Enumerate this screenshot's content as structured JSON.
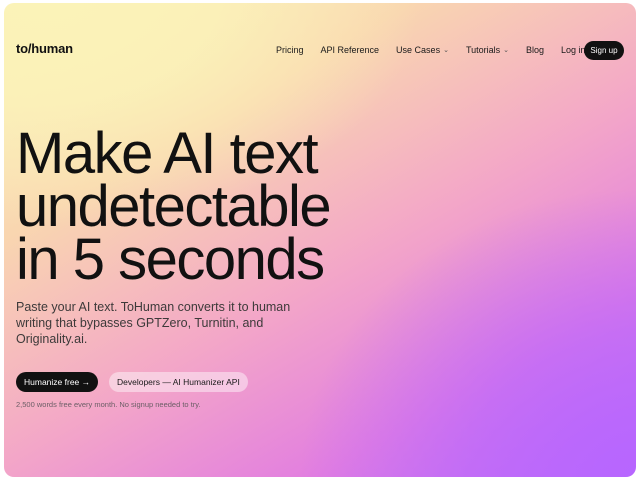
{
  "nav": {
    "logo": "to/human",
    "links": [
      {
        "label": "Pricing"
      },
      {
        "label": "API Reference"
      },
      {
        "label": "Use Cases",
        "caret": "⌄"
      },
      {
        "label": "Tutorials",
        "caret": "⌄"
      },
      {
        "label": "Blog"
      },
      {
        "label": "Log in"
      }
    ],
    "signup_label": "Sign up"
  },
  "hero": {
    "headline_lines": [
      "Make AI text",
      "undetectable",
      "in 5 seconds"
    ],
    "subtext_lines": [
      "Paste your AI text. ToHuman converts it to human",
      "writing that bypasses GPTZero, Turnitin, and",
      "Originality.ai."
    ],
    "primary_cta": "Humanize free →",
    "secondary_cta": "Developers — AI Humanizer API",
    "footnote": "2,500 words free every month. No signup needed to try."
  }
}
